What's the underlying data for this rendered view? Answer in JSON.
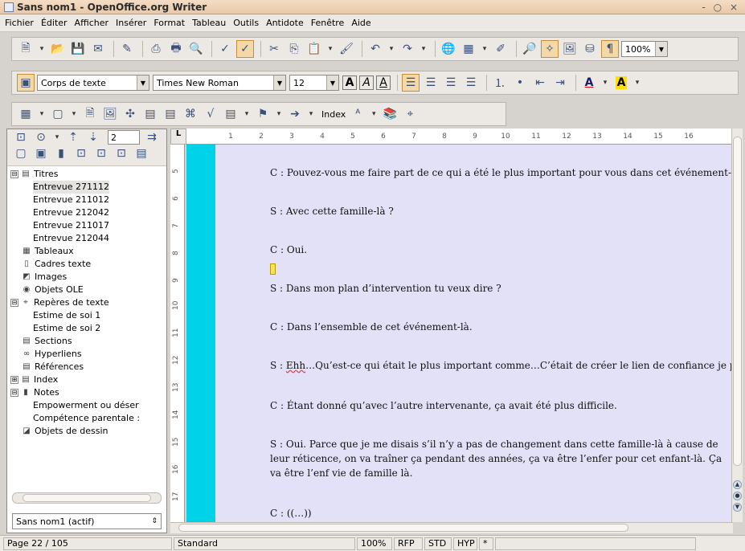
{
  "window": {
    "title": "Sans nom1 - OpenOffice.org Writer",
    "controls": "- ○ ×"
  },
  "menu": [
    "Fichier",
    "Éditer",
    "Afficher",
    "Insérer",
    "Format",
    "Tableau",
    "Outils",
    "Antidote",
    "Fenêtre",
    "Aide"
  ],
  "toolbar_standard": {
    "zoom": "100%"
  },
  "toolbar_format": {
    "paragraph_style": "Corps de texte",
    "font_name": "Times New Roman",
    "font_size": "12",
    "bold": "A",
    "italic": "A",
    "underline": "A"
  },
  "toolbar_insert": {
    "index_label": "Index"
  },
  "navigator": {
    "page_number": "2",
    "items": [
      {
        "label": "Titres",
        "level": 0,
        "expander": "⊟",
        "icon": "▤"
      },
      {
        "label": "Entrevue 271112",
        "level": 2,
        "selected": true
      },
      {
        "label": "Entrevue 211012",
        "level": 2
      },
      {
        "label": "Entrevue 212042",
        "level": 2
      },
      {
        "label": "Entrevue 211017",
        "level": 2
      },
      {
        "label": "Entrevue 212044",
        "level": 2
      },
      {
        "label": "Tableaux",
        "level": 1,
        "icon": "▦"
      },
      {
        "label": "Cadres texte",
        "level": 1,
        "icon": "▯"
      },
      {
        "label": "Images",
        "level": 1,
        "icon": "◩"
      },
      {
        "label": "Objets OLE",
        "level": 1,
        "icon": "◉"
      },
      {
        "label": "Repères de texte",
        "level": 0,
        "expander": "⊟",
        "icon": "⌖"
      },
      {
        "label": "Estime de soi 1",
        "level": 2
      },
      {
        "label": "Estime de soi 2",
        "level": 2
      },
      {
        "label": "Sections",
        "level": 1,
        "icon": "▤"
      },
      {
        "label": "Hyperliens",
        "level": 1,
        "icon": "∞"
      },
      {
        "label": "Références",
        "level": 1,
        "icon": "▤"
      },
      {
        "label": "Index",
        "level": 0,
        "expander": "⊞",
        "icon": "▤"
      },
      {
        "label": "Notes",
        "level": 0,
        "expander": "⊟",
        "icon": "▮"
      },
      {
        "label": "Empowerment ou déser",
        "level": 2
      },
      {
        "label": "Compétence parentale :",
        "level": 2
      },
      {
        "label": "Objets de dessin",
        "level": 1,
        "icon": "◪"
      }
    ],
    "document_select": "Sans nom1 (actif)"
  },
  "ruler": {
    "labels": [
      "1",
      "2",
      "3",
      "4",
      "5",
      "6",
      "7",
      "8",
      "9",
      "10",
      "11",
      "12",
      "13",
      "14",
      "15",
      "16"
    ],
    "vertical_labels": [
      "5",
      "6",
      "7",
      "8",
      "9",
      "10",
      "11",
      "12",
      "13",
      "14",
      "15",
      "16",
      "17"
    ]
  },
  "document": {
    "paragraphs": [
      "C : Pouvez-vous me faire part de ce qui a été le plus important pour vous dans cet événement-là ?",
      "S : Avec cette famille-là ?",
      "C : Oui.",
      "S : Dans mon plan d’intervention tu veux dire ?",
      "C : Dans l’ensemble de cet événement-là.",
      "Ehh",
      "…Qu’est-ce qui était le plus important comme…C’était de créer le lien de confiance je per",
      "C : Étant donné qu’avec l’autre intervenante, ça avait été plus difficile.",
      "S : Oui. Parce que je me disais s’il n’y a pas de changement dans cette famille-là à cause de leur réticence, on va traîner ça pendant des années, ça va être l’enfer pour cet enfant-là. Ça va être l’enf vie de famille là.",
      "C : ((…))"
    ],
    "speaker_prefix_s": "S : "
  },
  "status": {
    "page": "Page 22 / 105",
    "style": "Standard",
    "zoom": "100%",
    "rfp": "RFP",
    "std": "STD",
    "hyp": "HYP",
    "modified": "*"
  }
}
